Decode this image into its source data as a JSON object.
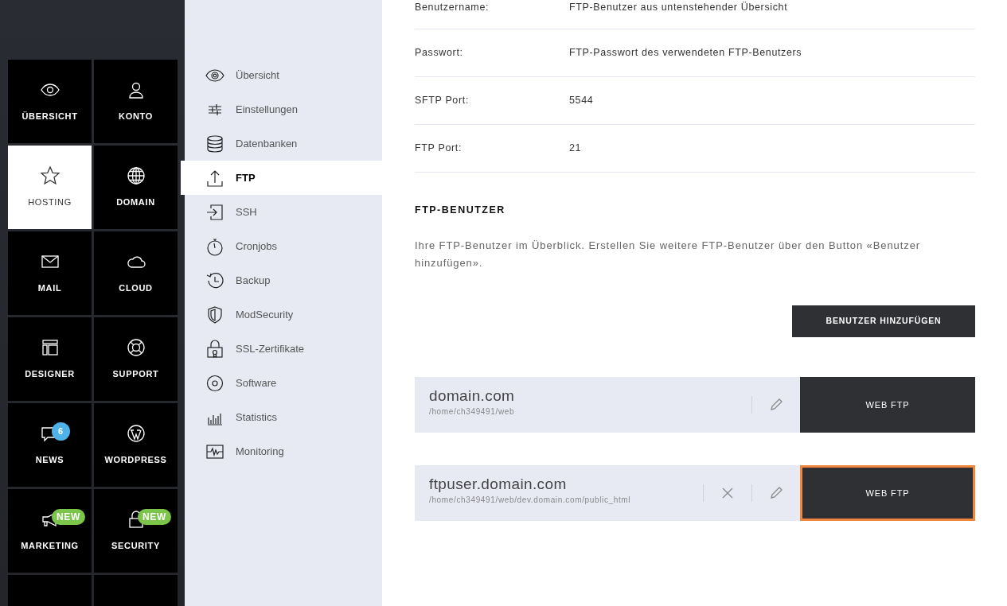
{
  "main_nav": {
    "tiles": [
      {
        "label": "ÜBERSICHT",
        "selected": false
      },
      {
        "label": "KONTO",
        "selected": false
      },
      {
        "label": "HOSTING",
        "selected": true
      },
      {
        "label": "DOMAIN",
        "selected": false
      },
      {
        "label": "MAIL",
        "selected": false
      },
      {
        "label": "CLOUD",
        "selected": false
      },
      {
        "label": "DESIGNER",
        "selected": false
      },
      {
        "label": "SUPPORT",
        "selected": false
      },
      {
        "label": "NEWS",
        "selected": false,
        "badge": {
          "text": "6",
          "kind": "count"
        }
      },
      {
        "label": "WORDPRESS",
        "selected": false
      },
      {
        "label": "MARKETING",
        "selected": false,
        "badge": {
          "text": "NEW",
          "kind": "tag"
        }
      },
      {
        "label": "SECURITY",
        "selected": false,
        "badge": {
          "text": "NEW",
          "kind": "tag"
        }
      },
      {
        "selected": false
      },
      {
        "selected": false
      }
    ]
  },
  "sub_nav": {
    "items": [
      {
        "label": "Übersicht",
        "selected": false
      },
      {
        "label": "Einstellungen",
        "selected": false
      },
      {
        "label": "Datenbanken",
        "selected": false
      },
      {
        "label": "FTP",
        "selected": true
      },
      {
        "label": "SSH",
        "selected": false
      },
      {
        "label": "Cronjobs",
        "selected": false
      },
      {
        "label": "Backup",
        "selected": false
      },
      {
        "label": "ModSecurity",
        "selected": false
      },
      {
        "label": "SSL-Zertifikate",
        "selected": false
      },
      {
        "label": "Software",
        "selected": false
      },
      {
        "label": "Statistics",
        "selected": false
      },
      {
        "label": "Monitoring",
        "selected": false
      }
    ]
  },
  "connection_info": [
    {
      "label": "Benutzername:",
      "value": "FTP-Benutzer aus untenstehender Übersicht"
    },
    {
      "label": "Passwort:",
      "value": "FTP-Passwort des verwendeten FTP-Benutzers"
    },
    {
      "label": "SFTP Port:",
      "value": "5544"
    },
    {
      "label": "FTP Port:",
      "value": "21"
    }
  ],
  "ftp_users": {
    "heading": "FTP-BENUTZER",
    "description": "Ihre FTP-Benutzer im Überblick. Erstellen Sie weitere FTP-Benutzer über den Button «Benutzer hinzufügen».",
    "add_button": "BENUTZER HINZUFÜGEN",
    "users": [
      {
        "name": "domain.com",
        "path": "/home/ch349491/web",
        "deletable": false,
        "button": "WEB FTP",
        "focused": false
      },
      {
        "name": "ftpuser.domain.com",
        "path": "/home/ch349491/web/dev.domain.com/public_html",
        "deletable": true,
        "button": "WEB FTP",
        "focused": true
      }
    ]
  }
}
